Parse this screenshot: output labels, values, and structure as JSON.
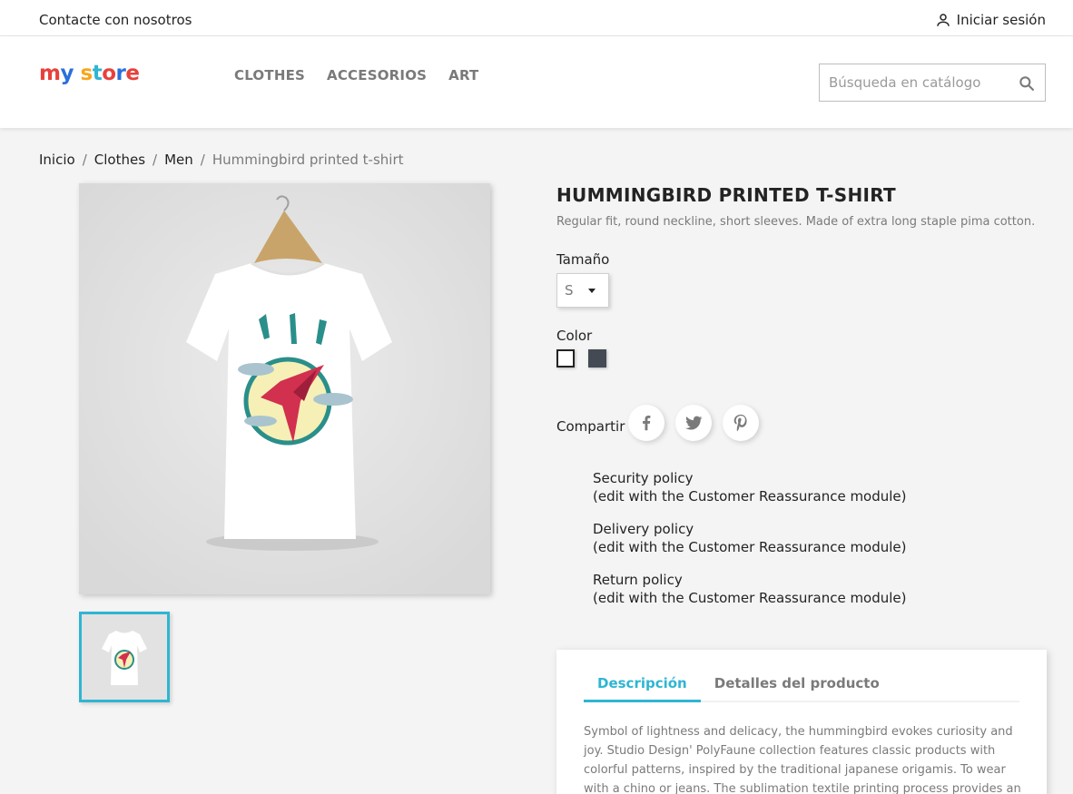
{
  "topbar": {
    "contact": "Contacte con nosotros",
    "signin": "Iniciar sesión"
  },
  "header": {
    "logo": {
      "part1": "my",
      "part2": "store"
    },
    "nav": [
      "CLOTHES",
      "ACCESORIOS",
      "ART"
    ],
    "search_placeholder": "Búsqueda en catálogo"
  },
  "breadcrumb": [
    "Inicio",
    "Clothes",
    "Men",
    "Hummingbird printed t-shirt"
  ],
  "product": {
    "title": "HUMMINGBIRD PRINTED T-SHIRT",
    "short_description": "Regular fit, round neckline, short sleeves. Made of extra long staple pima cotton.",
    "size_label": "Tamaño",
    "size_value": "S",
    "color_label": "Color",
    "colors": [
      "#ffffff",
      "#434a54"
    ],
    "share_label": "Compartir"
  },
  "reassurance": [
    {
      "title": "Security policy",
      "subtitle": "(edit with the Customer Reassurance module)"
    },
    {
      "title": "Delivery policy",
      "subtitle": "(edit with the Customer Reassurance module)"
    },
    {
      "title": "Return policy",
      "subtitle": "(edit with the Customer Reassurance module)"
    }
  ],
  "tabs": {
    "items": [
      "Descripción",
      "Detalles del producto"
    ],
    "description": "Symbol of lightness and delicacy, the hummingbird evokes curiosity and joy. Studio Design' PolyFaune collection features classic products with colorful patterns, inspired by the traditional japanese origamis. To wear with a chino or jeans. The sublimation textile printing process provides an exceptional"
  },
  "colors": {
    "accent": "#2fb5d2",
    "text": "#232323",
    "muted": "#7a7a7a",
    "background": "#f4f4f4"
  }
}
